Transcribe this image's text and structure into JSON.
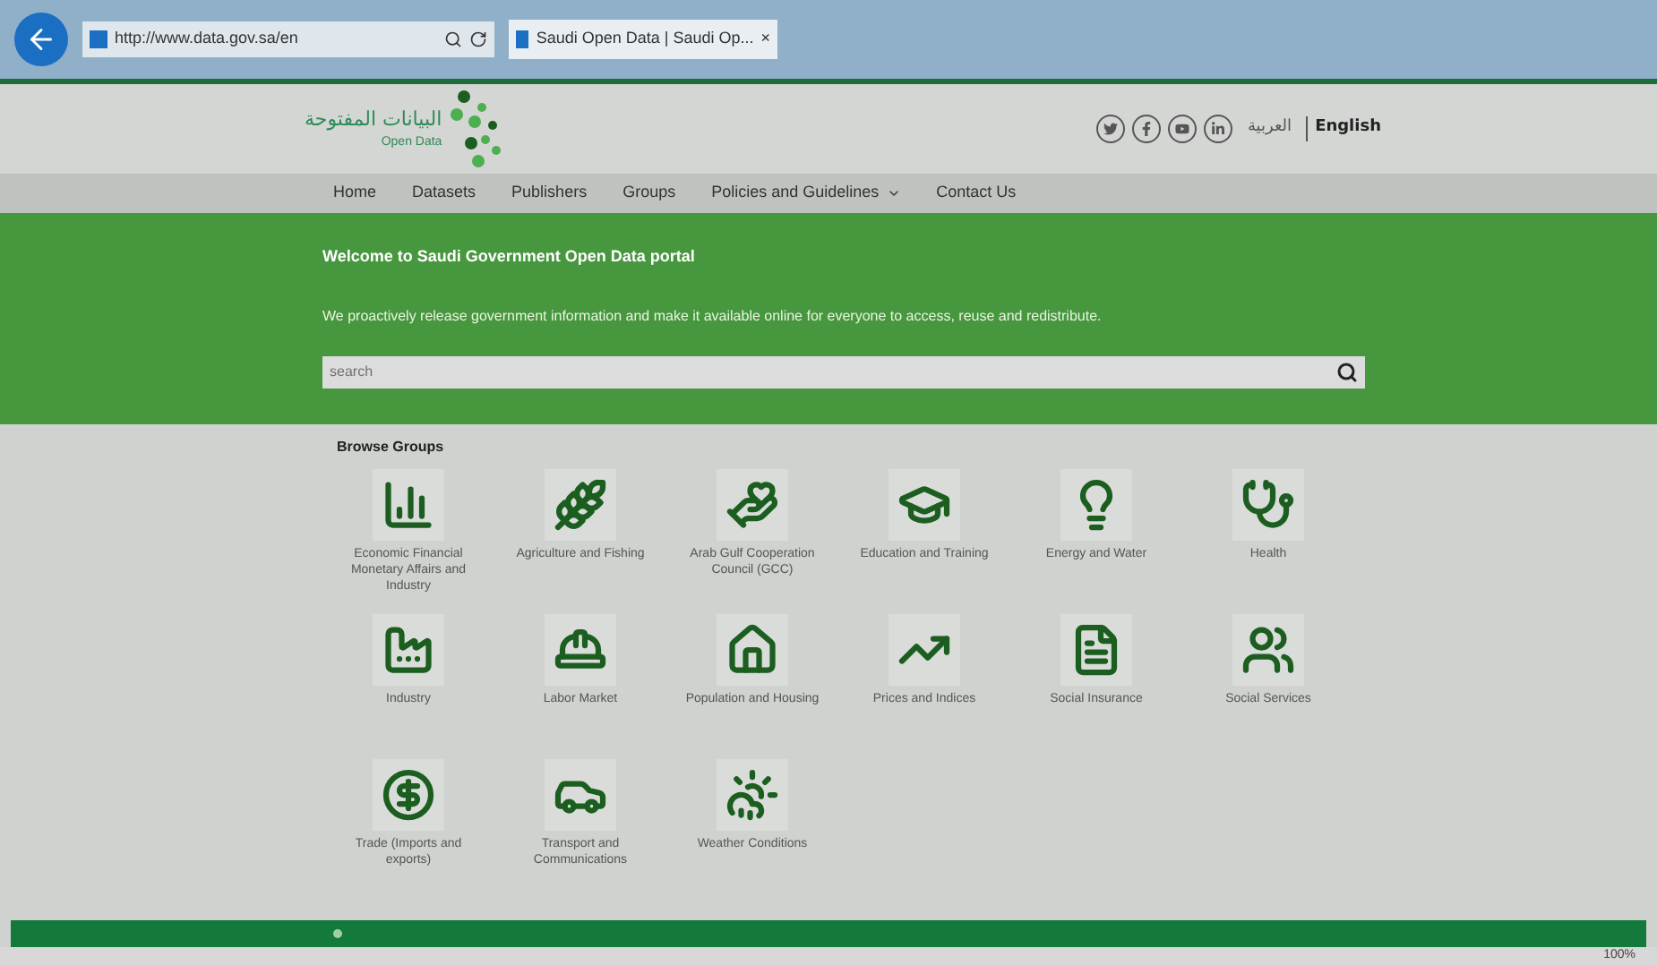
{
  "browser": {
    "address": "http://www.data.gov.sa/en",
    "tab_title": "Saudi Open Data | Saudi Op...",
    "tab_close": "×",
    "zoom": "100%"
  },
  "header": {
    "logo_arabic": "البيانات المفتوحة",
    "logo_english": "Open Data",
    "languages": [
      {
        "label": "العربية",
        "selected": false
      },
      {
        "label": "English",
        "selected": true
      }
    ]
  },
  "nav": [
    {
      "label": "Home",
      "dropdown": false
    },
    {
      "label": "Datasets",
      "dropdown": false
    },
    {
      "label": "Publishers",
      "dropdown": false
    },
    {
      "label": "Groups",
      "dropdown": false
    },
    {
      "label": "Policies and Guidelines",
      "dropdown": true
    },
    {
      "label": "Contact Us",
      "dropdown": false
    }
  ],
  "hero": {
    "title": "Welcome to Saudi Government Open Data portal",
    "text": "We proactively release government information and make it available online for everyone to access, reuse and redistribute.",
    "search": {
      "placeholder": "search"
    }
  },
  "groups": {
    "title": "Browse Groups",
    "items": [
      {
        "label": "Economic Financial Monetary Affairs and Industry"
      },
      {
        "label": "Agriculture and Fishing"
      },
      {
        "label": "Arab Gulf Cooperation Council (GCC)"
      },
      {
        "label": "Education and Training"
      },
      {
        "label": "Energy and Water"
      },
      {
        "label": "Health"
      },
      {
        "label": "Industry"
      },
      {
        "label": "Labor Market"
      },
      {
        "label": "Population and Housing"
      },
      {
        "label": "Prices and Indices"
      },
      {
        "label": "Social Insurance"
      },
      {
        "label": "Social Services"
      },
      {
        "label": "Trade (Imports and exports)"
      },
      {
        "label": "Transport and Communications"
      },
      {
        "label": "Weather Conditions"
      }
    ]
  }
}
